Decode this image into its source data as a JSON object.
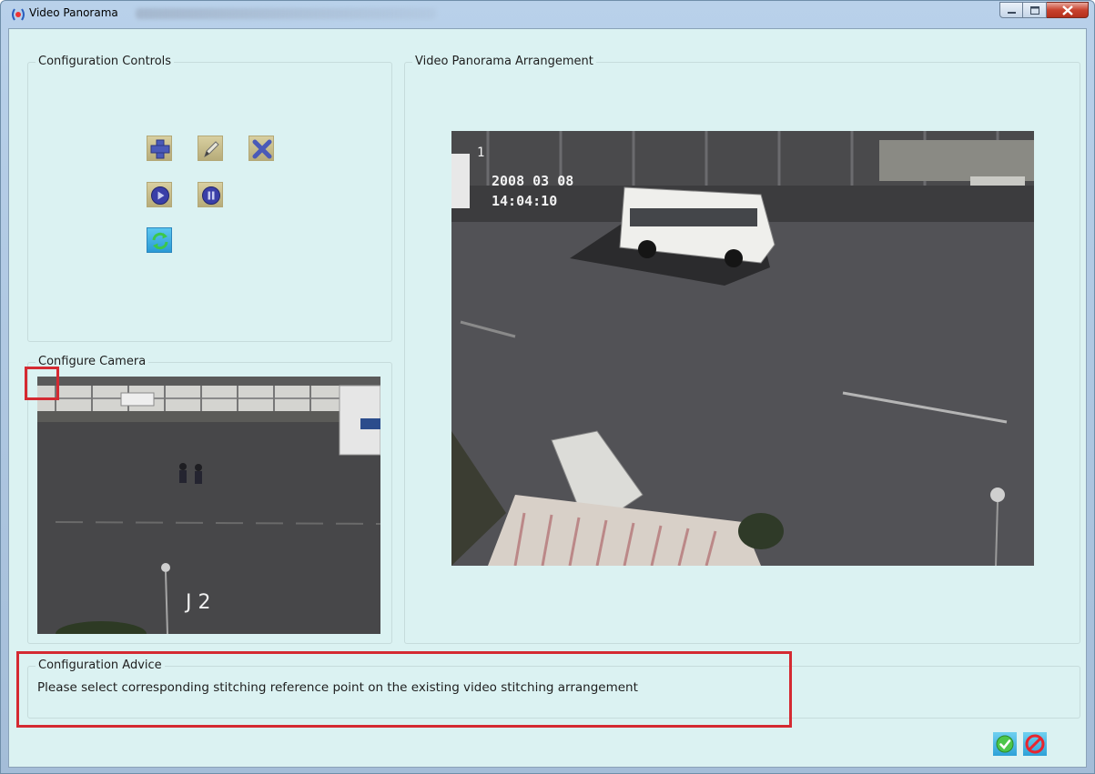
{
  "window": {
    "title": "Video Panorama",
    "icons": {
      "app": "panorama-app-icon",
      "minimize": "minimize-icon",
      "maximize": "maximize-icon",
      "close": "close-icon"
    }
  },
  "configuration_controls": {
    "title": "Configuration Controls",
    "buttons": [
      {
        "name": "add-button",
        "icon": "plus-icon"
      },
      {
        "name": "edit-button",
        "icon": "pencil-icon"
      },
      {
        "name": "delete-button",
        "icon": "cross-icon"
      },
      {
        "name": "play-button",
        "icon": "play-icon"
      },
      {
        "name": "pause-button",
        "icon": "pause-icon"
      },
      {
        "name": "refresh-button",
        "icon": "refresh-icon"
      }
    ]
  },
  "configure_camera": {
    "title": "Configure Camera",
    "overlay_text": "J 2"
  },
  "panorama_arrangement": {
    "title": "Video Panorama Arrangement",
    "overlay_cam": "1",
    "overlay_date": "2008 03 08",
    "overlay_time": "14:04:10"
  },
  "advice": {
    "title": "Configuration Advice",
    "text": "Please select corresponding stitching reference point on the existing video stitching arrangement"
  },
  "dialog_buttons": {
    "ok_icon": "checkmark-icon",
    "cancel_icon": "no-entry-icon"
  },
  "colors": {
    "panel_bg": "#dbf2f2",
    "highlight": "#d42a32",
    "button_bg": "#c8bd8b",
    "play_blue": "#3a3fa8"
  }
}
